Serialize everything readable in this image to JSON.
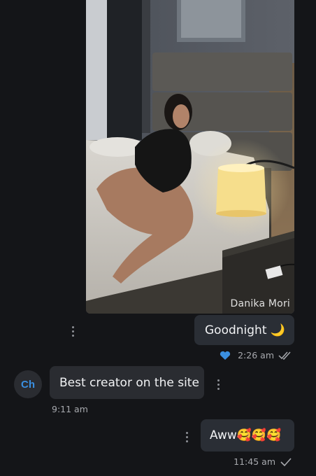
{
  "photo": {
    "watermark": "Danika Mori"
  },
  "messages": [
    {
      "direction": "outgoing",
      "text": "Goodnight 🌙",
      "liked": true,
      "time": "2:26 am",
      "status": "read"
    },
    {
      "direction": "incoming",
      "avatar_initials": "Ch",
      "text": "Best creator on the site",
      "time": "9:11 am"
    },
    {
      "direction": "outgoing",
      "text": "Aww🥰🥰🥰",
      "time": "11:45 am",
      "status": "sent"
    }
  ],
  "colors": {
    "background": "#141518",
    "bubble": "#2a2c31",
    "accent": "#3a8fe0",
    "meta_text": "#a7a9ae"
  }
}
